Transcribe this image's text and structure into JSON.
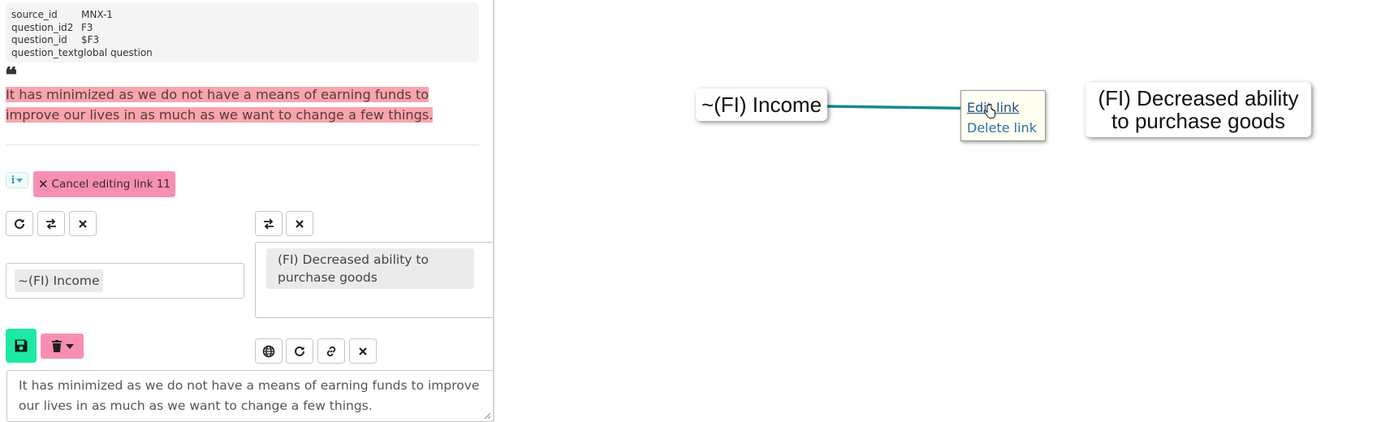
{
  "metadata": {
    "rows": [
      {
        "key": "source_id",
        "value": "MNX-1"
      },
      {
        "key": "question_id2",
        "value": "F3"
      },
      {
        "key": "question_id",
        "value": "$F3"
      },
      {
        "key": "question_text",
        "value": "global question"
      }
    ]
  },
  "quote": {
    "icon": "quote-left-icon",
    "text": "It has minimized as we do not have a means of earning funds to improve our lives in as much as we want to change a few things."
  },
  "toolbar": {
    "info_icon": "info-icon",
    "cancel_label": "Cancel editing link 11"
  },
  "link_editor": {
    "from_node": "~(FI) Income",
    "to_node": "(FI) Decreased ability to purchase goods",
    "source_text": "It has minimized as we do not have a means of earning funds to improve our lives in as much as we want to change a few things."
  },
  "map": {
    "nodes": [
      {
        "label": "~(FI) Income"
      },
      {
        "label": "(FI) Decreased ability to purchase goods"
      }
    ],
    "edge_color": "#138a8e",
    "popup": {
      "edit_label": "Edit link",
      "delete_label": "Delete link"
    }
  },
  "colors": {
    "highlight": "#f9a5ad",
    "cancel_button": "#f78fb3",
    "save_button": "#1de9a6",
    "link_text": "#2f6fa8"
  }
}
